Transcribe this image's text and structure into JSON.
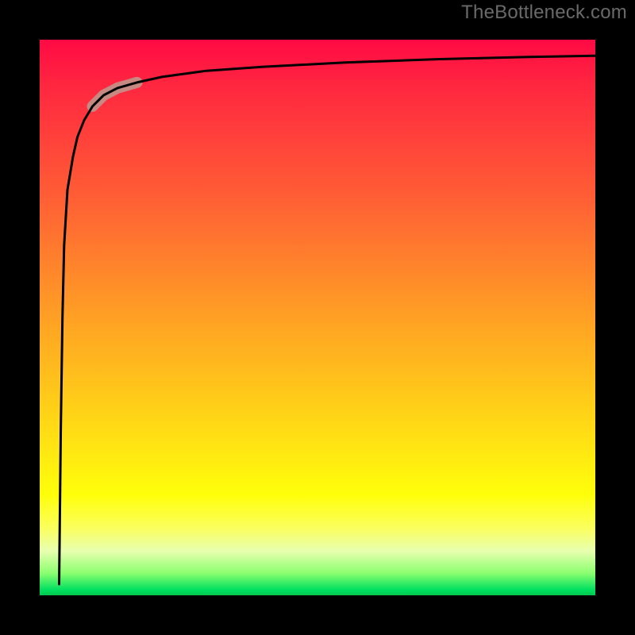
{
  "watermark": "TheBottleneck.com",
  "colors": {
    "border": "#000000",
    "curve": "#000000",
    "highlight": "#c68a83",
    "gradient_top": "#ff0a44",
    "gradient_bottom": "#00c850"
  },
  "chart_data": {
    "type": "line",
    "title": "",
    "xlabel": "",
    "ylabel": "",
    "xlim": [
      0,
      100
    ],
    "ylim": [
      0,
      100
    ],
    "grid": false,
    "legend": false,
    "note": "Axes are unlabeled; values are estimated from pixel positions on a 0–100 normalized scale.",
    "series": [
      {
        "name": "curve",
        "x": [
          3.5,
          3.8,
          4.1,
          4.4,
          5.0,
          6.0,
          6.8,
          8.0,
          9.5,
          11.5,
          14.0,
          17.5,
          22.0,
          30.0,
          40.0,
          55.0,
          72.0,
          88.0,
          100.0
        ],
        "y": [
          2.0,
          30.0,
          50.0,
          63.0,
          73.0,
          79.0,
          82.5,
          85.5,
          88.0,
          90.0,
          91.3,
          92.3,
          93.3,
          94.4,
          95.1,
          95.9,
          96.5,
          96.9,
          97.1
        ]
      }
    ],
    "highlight_segment": {
      "description": "Thick pale-red stroke overlaying a short segment of the curve in the upper-left region.",
      "x_range": [
        10.0,
        17.0
      ],
      "y_range": [
        88.3,
        92.1
      ]
    }
  }
}
